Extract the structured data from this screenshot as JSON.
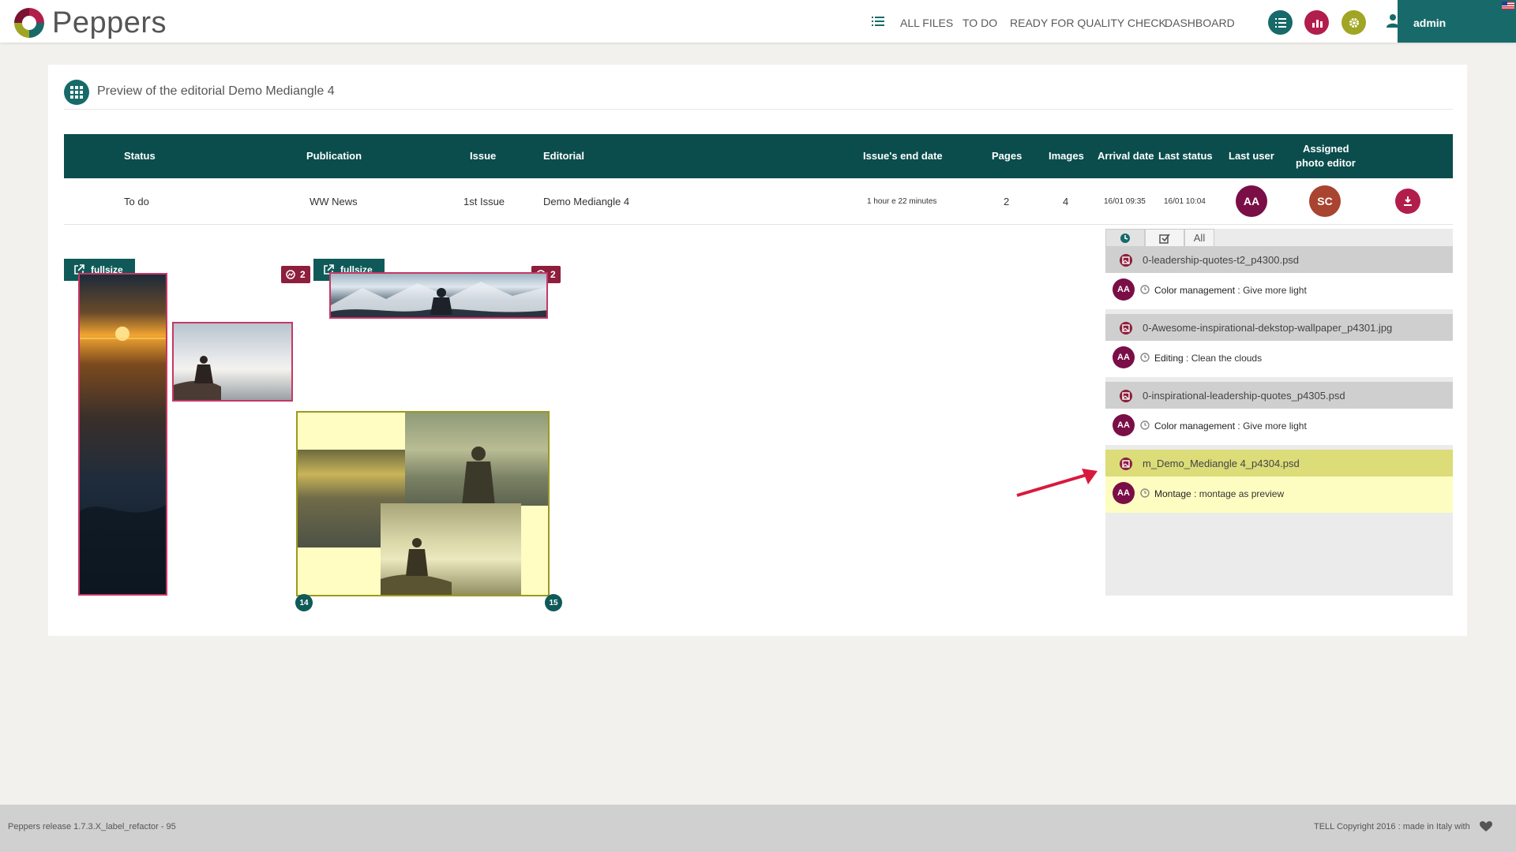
{
  "app": {
    "name": "Peppers",
    "nav": [
      "ALL FILES",
      "TO DO",
      "READY FOR QUALITY CHECK",
      "DASHBOARD"
    ],
    "user": "admin",
    "icons": [
      "list-icon",
      "chart-icon",
      "gear-icon",
      "user-icon",
      "flag-icon"
    ]
  },
  "page": {
    "title": "Preview of the editorial Demo Mediangle 4"
  },
  "table": {
    "headers": {
      "status": "Status",
      "publication": "Publication",
      "issue": "Issue",
      "editorial": "Editorial",
      "end_date": "Issue's end date",
      "pages": "Pages",
      "images": "Images",
      "arrival": "Arrival date",
      "last_status": "Last status",
      "last_user": "Last user",
      "photo_editor_1": "Assigned",
      "photo_editor_2": "photo editor"
    },
    "row": {
      "status": "To do",
      "publication": "WW News",
      "issue": "1st Issue",
      "editorial": "Demo Mediangle 4",
      "end_date": "1 hour e 22 minutes",
      "pages": "2",
      "images": "4",
      "arrival": "16/01 09:35",
      "last_status": "16/01 10:04",
      "last_user": "AA",
      "photo_editor": "SC"
    }
  },
  "preview": {
    "fullsize_label": "fullsize",
    "badge_count_1": "2",
    "badge_count_2": "2",
    "page_left": "14",
    "page_right": "15"
  },
  "side_panel": {
    "tabs": {
      "all": "All"
    },
    "files": [
      {
        "name": "0-leadership-quotes-t2_p4300.psd",
        "user": "AA",
        "task": "Color management",
        "sep": " : ",
        "note": "Give more light"
      },
      {
        "name": "0-Awesome-inspirational-dekstop-wallpaper_p4301.jpg",
        "user": "AA",
        "task": "Editing",
        "sep": " : ",
        "note": "Clean the clouds"
      },
      {
        "name": "0-inspirational-leadership-quotes_p4305.psd",
        "user": "AA",
        "task": "Color management",
        "sep": " : ",
        "note": "Give more light"
      },
      {
        "name": "m_Demo_Mediangle 4_p4304.psd",
        "user": "AA",
        "task": "Montage",
        "sep": " : ",
        "note": "montage as preview"
      }
    ]
  },
  "footer": {
    "release": "Peppers release 1.7.3.X_label_refactor - 95",
    "copyright": "TELL Copyright 2016 : made in Italy with"
  },
  "colors": {
    "brand_teal": "#176a69",
    "table_header": "#0a4d4c",
    "accent_red": "#b21e4b",
    "accent_olive": "#a0a524",
    "highlight_yellow": "#fefdc1"
  }
}
